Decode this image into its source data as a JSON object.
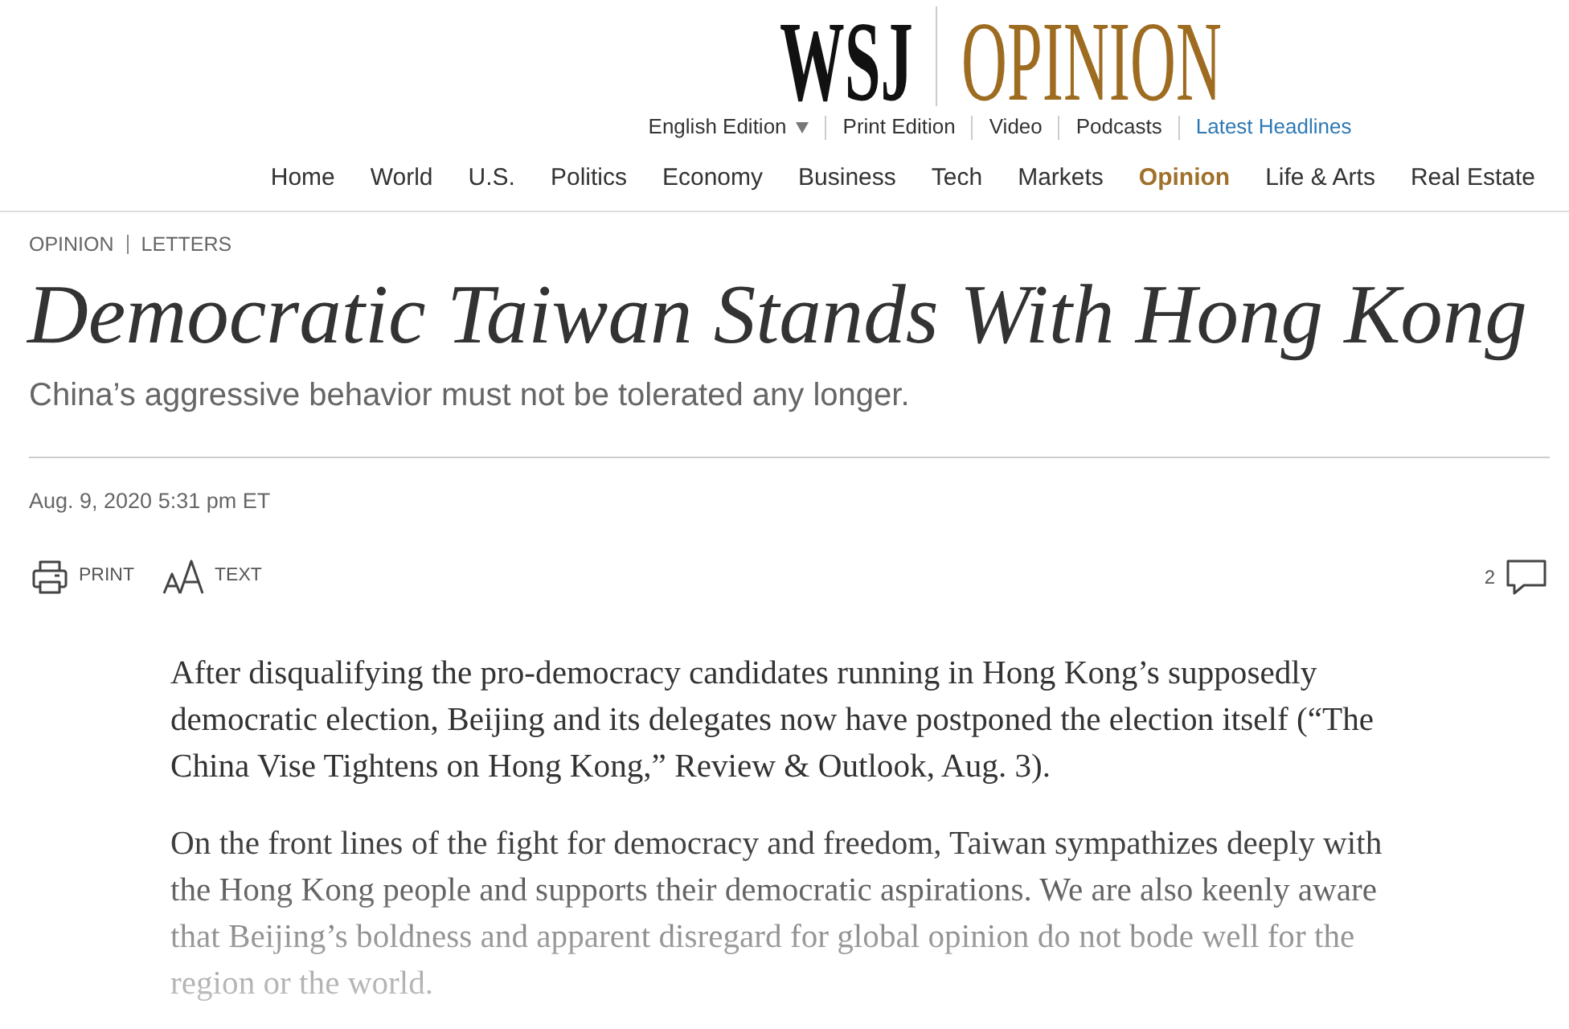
{
  "logo": {
    "brand": "WSJ",
    "section": "OPINION"
  },
  "edition_nav": [
    {
      "label": "English Edition",
      "kind": "dropdown"
    },
    {
      "label": "Print Edition",
      "kind": "link"
    },
    {
      "label": "Video",
      "kind": "link"
    },
    {
      "label": "Podcasts",
      "kind": "link"
    },
    {
      "label": "Latest Headlines",
      "kind": "featured"
    }
  ],
  "main_nav": [
    {
      "label": "Home",
      "selected": false
    },
    {
      "label": "World",
      "selected": false
    },
    {
      "label": "U.S.",
      "selected": false
    },
    {
      "label": "Politics",
      "selected": false
    },
    {
      "label": "Economy",
      "selected": false
    },
    {
      "label": "Business",
      "selected": false
    },
    {
      "label": "Tech",
      "selected": false
    },
    {
      "label": "Markets",
      "selected": false
    },
    {
      "label": "Opinion",
      "selected": true
    },
    {
      "label": "Life & Arts",
      "selected": false
    },
    {
      "label": "Real Estate",
      "selected": false
    }
  ],
  "breadcrumb": [
    "OPINION",
    "LETTERS"
  ],
  "headline": "Democratic Taiwan Stands With Hong Kong",
  "subheadline": "China’s aggressive behavior must not be tolerated any longer.",
  "timestamp": "Aug. 9, 2020 5:31 pm ET",
  "tools": [
    {
      "kind": "print",
      "label": "PRINT"
    },
    {
      "kind": "text_size",
      "label": "TEXT"
    }
  ],
  "comments": {
    "count": "2"
  },
  "body": [
    {
      "text": "After disqualifying the pro-democracy candidates running in Hong Kong’s supposedly democratic election, Beijing and its delegates now have postponed the election itself (“The China Vise Tightens on Hong Kong,” Review & Outlook, Aug. 3).",
      "faded": false
    },
    {
      "text": "On the front lines of the fight for democracy and freedom, Taiwan sympathizes deeply with the Hong Kong people and supports their democratic aspirations. We are also keenly aware that Beijing’s boldness and apparent disregard for global opinion do not bode well for the region or the world.",
      "faded": true
    }
  ]
}
